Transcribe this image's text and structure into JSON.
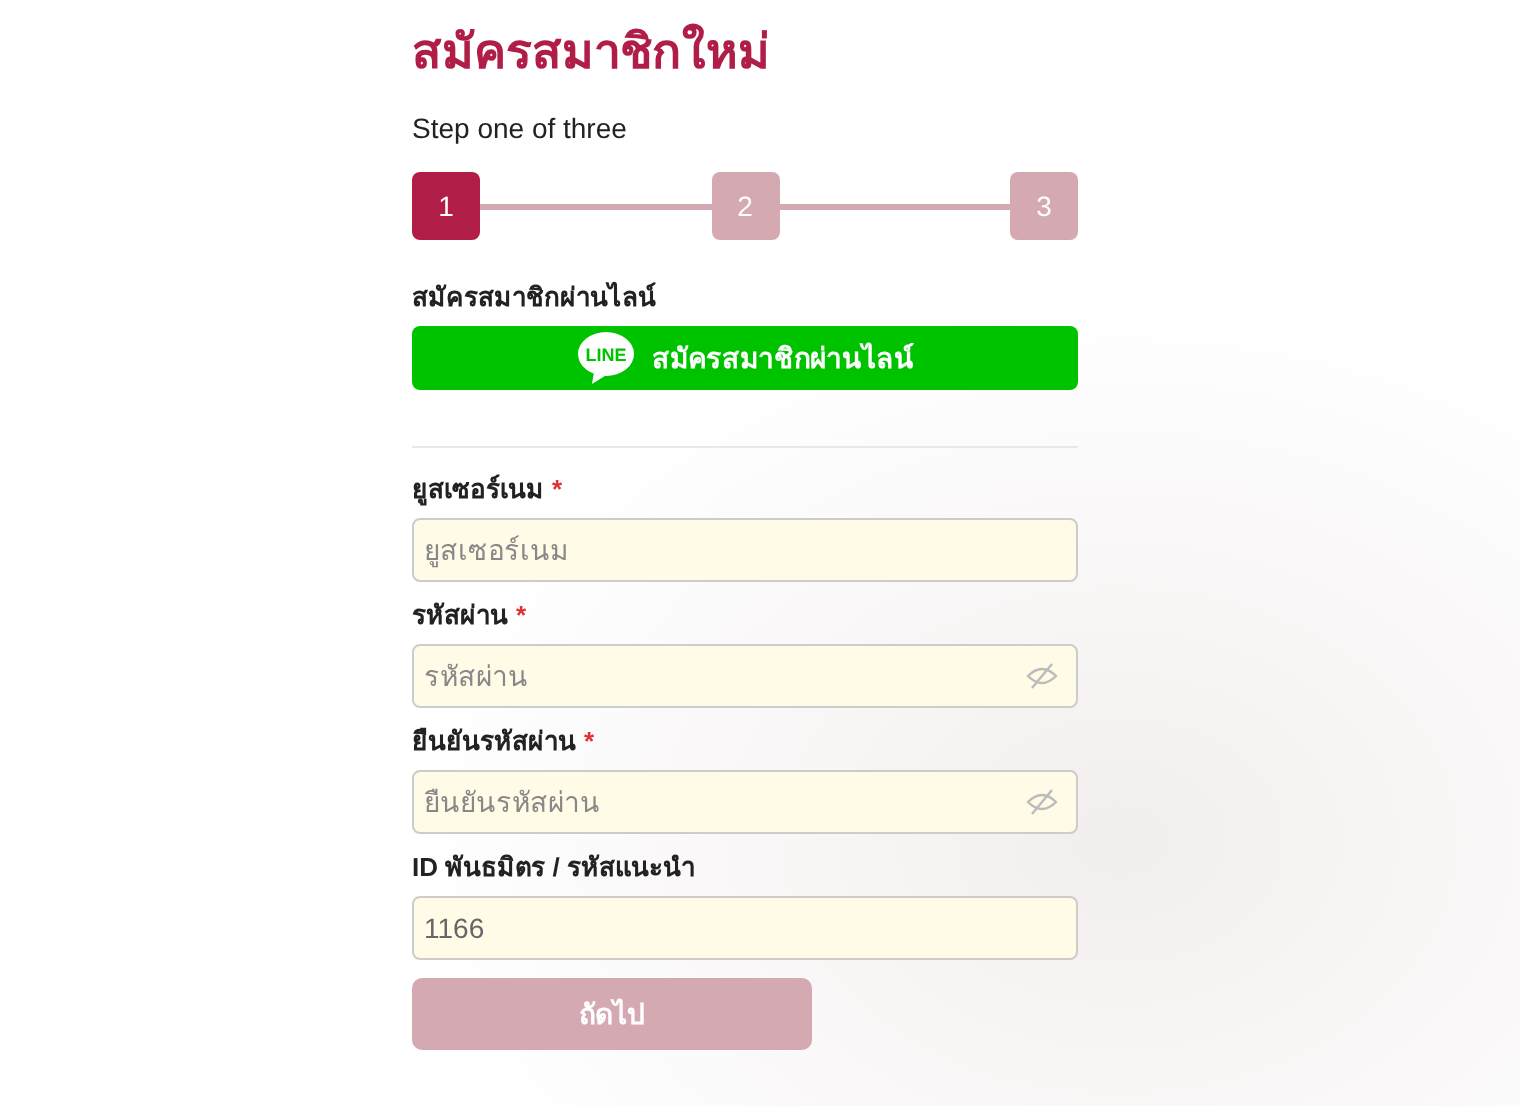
{
  "title": "สมัครสมาชิกใหม่",
  "step_caption": "Step one of three",
  "steps": [
    {
      "label": "1",
      "selected": true
    },
    {
      "label": "2",
      "selected": false
    },
    {
      "label": "3",
      "selected": false
    }
  ],
  "line_signup": {
    "label": "สมัครสมาชิกผ่านไลน์",
    "badge": "LINE",
    "button": "สมัครสมาชิกผ่านไลน์"
  },
  "fields": [
    {
      "kind": "text",
      "label": "ยูสเซอร์เนม",
      "required_mark": "*",
      "placeholder": "ยูสเซอร์เนม"
    },
    {
      "kind": "password",
      "label": "รหัสผ่าน",
      "required_mark": "*",
      "placeholder": "รหัสผ่าน"
    },
    {
      "kind": "password",
      "label": "ยืนยันรหัสผ่าน",
      "required_mark": "*",
      "placeholder": "ยืนยันรหัสผ่าน"
    },
    {
      "kind": "text",
      "label": "ID พันธมิตร / รหัสแนะนำ",
      "value": "1166"
    }
  ],
  "next_button": {
    "label": "ถัดไป",
    "disabled": true
  }
}
